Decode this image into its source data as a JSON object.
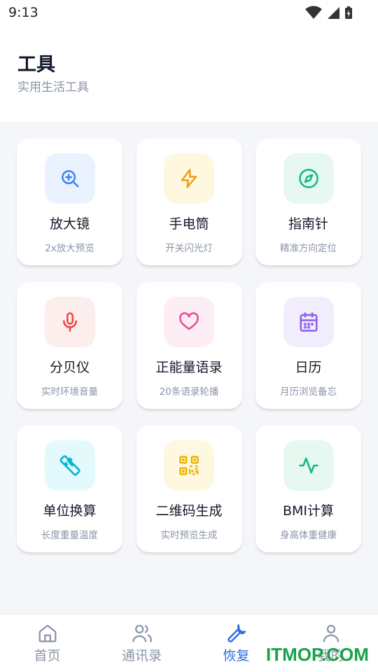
{
  "status": {
    "time": "9:13"
  },
  "header": {
    "title": "工具",
    "subtitle": "实用生活工具"
  },
  "tools": [
    {
      "id": "magnifier",
      "title": "放大镜",
      "desc": "2x放大预览",
      "icon": "zoom-in-icon",
      "color": "#3b82f6",
      "bg": "#eaf2ff"
    },
    {
      "id": "flashlight",
      "title": "手电筒",
      "desc": "开关闪光灯",
      "icon": "lightning-icon",
      "color": "#f59e0b",
      "bg": "#fff8e1"
    },
    {
      "id": "compass",
      "title": "指南针",
      "desc": "精准方向定位",
      "icon": "compass-icon",
      "color": "#10b981",
      "bg": "#e6f8ef"
    },
    {
      "id": "decibel",
      "title": "分贝仪",
      "desc": "实时环境音量",
      "icon": "microphone-icon",
      "color": "#ef4444",
      "bg": "#fdeeee"
    },
    {
      "id": "quotes",
      "title": "正能量语录",
      "desc": "20条语录轮播",
      "icon": "heart-icon",
      "color": "#ec4899",
      "bg": "#fdedf5"
    },
    {
      "id": "calendar",
      "title": "日历",
      "desc": "月历浏览备忘",
      "icon": "calendar-icon",
      "color": "#8b5cf6",
      "bg": "#f1edfd"
    },
    {
      "id": "unit",
      "title": "单位换算",
      "desc": "长度重量温度",
      "icon": "ruler-icon",
      "color": "#06b6d4",
      "bg": "#e3f9fb"
    },
    {
      "id": "qrcode",
      "title": "二维码生成",
      "desc": "实时预览生成",
      "icon": "qrcode-icon",
      "color": "#eab308",
      "bg": "#fff8e1"
    },
    {
      "id": "bmi",
      "title": "BMI计算",
      "desc": "身高体重健康",
      "icon": "activity-icon",
      "color": "#10b981",
      "bg": "#e6f8ef"
    }
  ],
  "nav": [
    {
      "label": "首页",
      "icon": "home-icon",
      "active": false
    },
    {
      "label": "通讯录",
      "icon": "contacts-icon",
      "active": false
    },
    {
      "label": "恢复",
      "icon": "wrench-icon",
      "active": true
    },
    {
      "label": "我的",
      "icon": "user-icon",
      "active": false
    }
  ],
  "watermark": "ITMOP.COM"
}
